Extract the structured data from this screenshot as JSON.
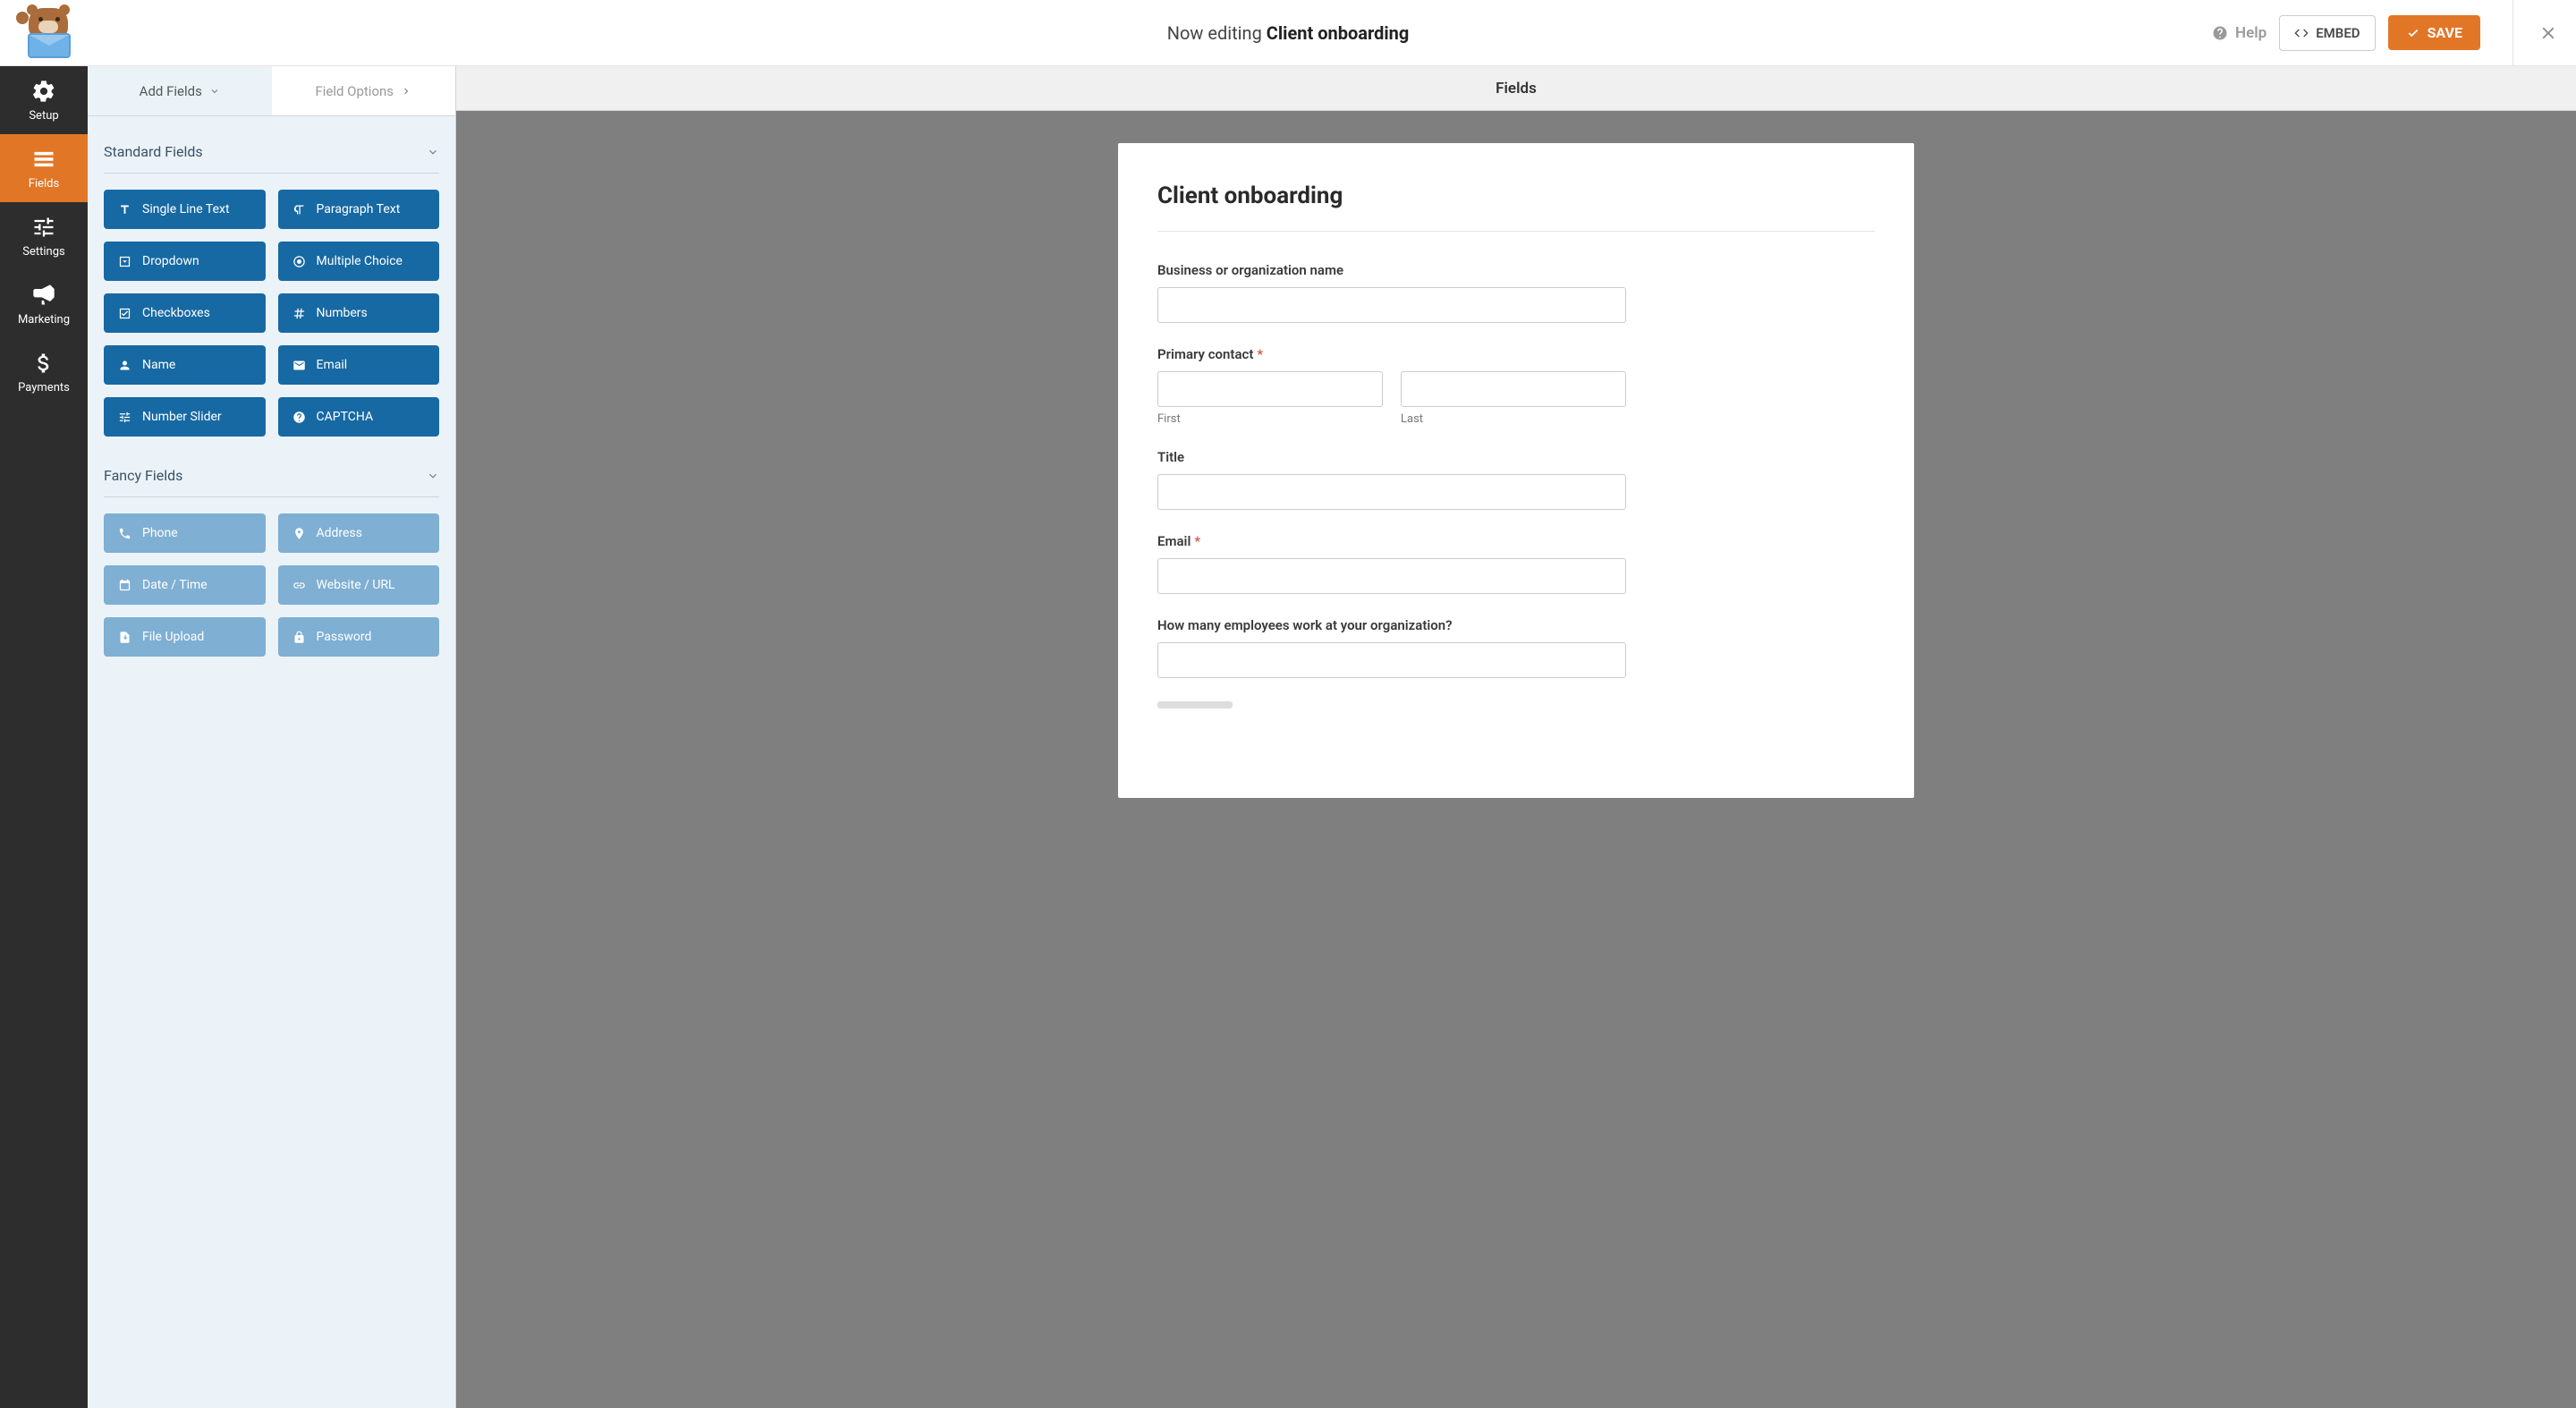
{
  "header": {
    "editing_prefix": "Now editing",
    "editing_title": "Client onboarding",
    "help": "Help",
    "embed": "EMBED",
    "save": "SAVE"
  },
  "sidebar": {
    "items": [
      {
        "label": "Setup"
      },
      {
        "label": "Fields"
      },
      {
        "label": "Settings"
      },
      {
        "label": "Marketing"
      },
      {
        "label": "Payments"
      }
    ]
  },
  "panel": {
    "header": "Fields",
    "tabs": {
      "add": "Add Fields",
      "options": "Field Options"
    },
    "standard": {
      "title": "Standard Fields",
      "items": [
        "Single Line Text",
        "Paragraph Text",
        "Dropdown",
        "Multiple Choice",
        "Checkboxes",
        "Numbers",
        "Name",
        "Email",
        "Number Slider",
        "CAPTCHA"
      ]
    },
    "fancy": {
      "title": "Fancy Fields",
      "items": [
        "Phone",
        "Address",
        "Date / Time",
        "Website / URL",
        "File Upload",
        "Password"
      ]
    }
  },
  "preview": {
    "header": "Fields",
    "form_title": "Client onboarding",
    "fields": {
      "business": {
        "label": "Business or organization name"
      },
      "contact": {
        "label": "Primary contact",
        "first": "First",
        "last": "Last"
      },
      "title": {
        "label": "Title"
      },
      "email": {
        "label": "Email"
      },
      "employees": {
        "label": "How many employees work at your organization?"
      }
    }
  }
}
